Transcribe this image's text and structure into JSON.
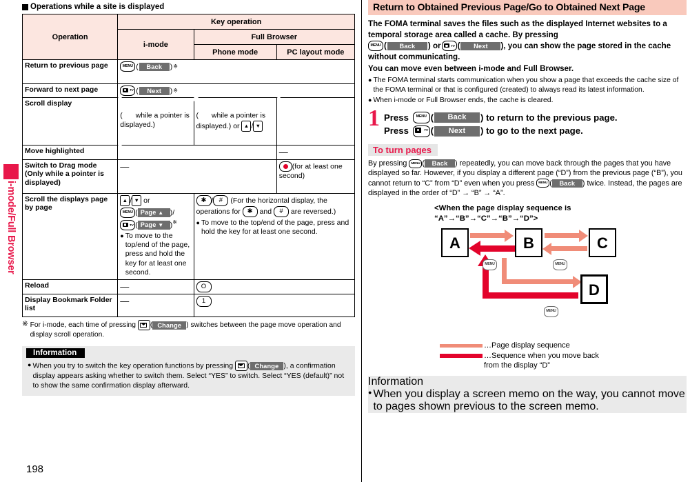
{
  "side_tab": {
    "label": "i-mode/Full Browser",
    "color": "#E8174A"
  },
  "page_number": "198",
  "left": {
    "section_heading": "Operations while a site is displayed",
    "table": {
      "headers": {
        "operation": "Operation",
        "key_operation": "Key operation",
        "imode": "i-mode",
        "full_browser": "Full Browser",
        "phone_mode": "Phone mode",
        "pc_layout_mode": "PC layout mode"
      },
      "rows": [
        {
          "operation": "Return to previous page",
          "imode": "MENU(Back)※",
          "spans_all": true
        },
        {
          "operation": "Forward to next page",
          "imode": "camera-tv(Next)※",
          "spans_all": true
        },
        {
          "operation": "Scroll display",
          "imode": "nav-key  (nav-key while a pointer is displayed.)",
          "imode_note": "( nav-key while a pointer is displayed.)",
          "phone": "nav-key  (nav-key while a pointer is displayed.) or ▲/▼",
          "phone_note": "( nav-key while a pointer is displayed.) or ",
          "pc": "nav-key-solid"
        },
        {
          "operation": "Move highlighted",
          "imode": "nav-key",
          "pc": "—"
        },
        {
          "operation": "Switch to Drag mode (Only while a pointer is displayed)",
          "middle": "—",
          "pc": "(for at least one second)"
        },
        {
          "operation": "Scroll the displays page by page",
          "imode_lines": [
            "▲/▼ or",
            "MENU(Page ▲)/",
            "camera-tv(Page ▼)※"
          ],
          "imode_bullet": "To move to the top/end of the page, press and hold the key for at least one second.",
          "fb_text": "(For the horizontal display, the operations for ✳ and # are reversed.)",
          "fb_bullet": "To move to the top/end of the page, press and hold the key for at least one second."
        },
        {
          "operation": "Reload",
          "imode": "—",
          "fb": "O"
        },
        {
          "operation": "Display Bookmark Folder list",
          "imode": "—",
          "fb": "1"
        }
      ]
    },
    "footnote": {
      "marker": "※",
      "text_before": "For i-mode, each time of pressing ",
      "key_label": "Change",
      "text_after": ") switches between the page move operation and display scroll operation."
    },
    "information": {
      "title": "Information",
      "bullet_before": "When you try to switch the key operation functions by pressing ",
      "bullet_key": "Change",
      "bullet_after": "), a confirmation display appears asking whether to switch them. Select “YES” to switch. Select “YES (default)” not to show the same confirmation display afterward."
    }
  },
  "right": {
    "banner": "Return to Obtained Previous Page/Go to Obtained Next Page",
    "lead_1": "The FOMA terminal saves the files such as the displayed Internet websites to a temporal storage area called a cache. By pressing",
    "lead_key_back": "Back",
    "lead_mid": ") or ",
    "lead_key_next": "Next",
    "lead_2": "), you can show the page stored in the cache without communicating.",
    "lead_3": "You can move even between i-mode and Full Browser.",
    "bullets": [
      "The FOMA terminal starts communication when you show a page that exceeds the cache size of the FOMA terminal or that is configured (created) to always read its latest information.",
      "When i-mode or Full Browser ends, the cache is cleared."
    ],
    "step": {
      "number": "1",
      "line1_a": "Press",
      "line1_key": "Back",
      "line1_b": ") to return to the previous page.",
      "line2_a": "Press",
      "line2_key": "Next",
      "line2_b": ") to go to the next page."
    },
    "subhead": "To turn pages",
    "para_a": "By pressing ",
    "para_key": "Back",
    "para_b": ") repeatedly, you can move back through the pages that you have displayed so far. However, if you display a different page (“D”) from the previous page (“B”), you cannot return to “C” from “D” even when you press ",
    "para_key2": "Back",
    "para_c": ") twice. Instead, the pages are displayed in the order of “D” → “B” → “A”.",
    "diagram_caption_1": "<When the page display sequence is",
    "diagram_caption_2": "“A”→“B”→“C”→“B”→“D”>",
    "diagram": {
      "nodes": [
        "A",
        "B",
        "C",
        "D"
      ],
      "menu_badges": [
        "MENU",
        "MENU",
        "MENU"
      ],
      "arrow_colors": {
        "forward": "#F08C78",
        "back": "#E3032B"
      }
    },
    "legend": {
      "line1": "…Page display sequence",
      "line2": "…Sequence when you move back",
      "line2_cont": "from the display “D”"
    },
    "information": {
      "title": "Information",
      "bullet": "When you display a screen memo on the way, you cannot move to pages shown previous to the screen memo."
    }
  }
}
